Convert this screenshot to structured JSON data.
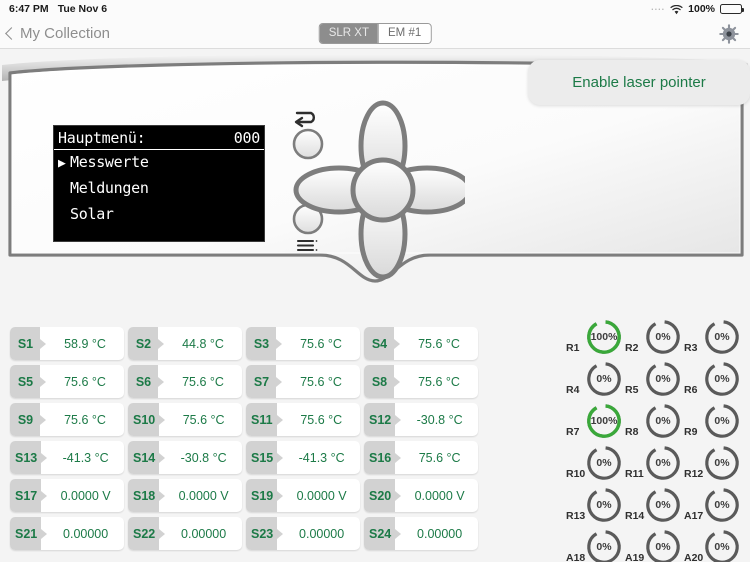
{
  "statusbar": {
    "time": "6:47 PM",
    "date": "Tue Nov 6",
    "dots": "....",
    "wifi_icon": "wifi-icon",
    "battery_pct": "100%",
    "battery_icon": "battery-full-icon"
  },
  "navbar": {
    "back_label": "My Collection",
    "back_icon": "chevron-left-icon",
    "gear_icon": "gear-icon",
    "segments": [
      {
        "label": "SLR XT",
        "selected": true
      },
      {
        "label": "EM #1",
        "selected": false
      }
    ]
  },
  "device": {
    "laser_button": "Enable laser pointer",
    "lcd": {
      "header_left": "Hauptmenü:",
      "header_right": "000",
      "caret": "▶",
      "items": [
        {
          "caret": "▶",
          "label": "Messwerte"
        },
        {
          "caret": "",
          "label": "Meldungen"
        },
        {
          "caret": "",
          "label": "Solar"
        }
      ]
    },
    "controls": {
      "back_icon": "undo-arrow-icon",
      "back_button": "round-button-back",
      "menu_icon": "list-menu-icon",
      "menu_button": "round-button-menu",
      "dpad": "dpad-navigation"
    }
  },
  "sensors": [
    {
      "label": "S1",
      "value": "58.9 °C"
    },
    {
      "label": "S2",
      "value": "44.8 °C"
    },
    {
      "label": "S3",
      "value": "75.6 °C"
    },
    {
      "label": "S4",
      "value": "75.6 °C"
    },
    {
      "label": "S5",
      "value": "75.6 °C"
    },
    {
      "label": "S6",
      "value": "75.6 °C"
    },
    {
      "label": "S7",
      "value": "75.6 °C"
    },
    {
      "label": "S8",
      "value": "75.6 °C"
    },
    {
      "label": "S9",
      "value": "75.6 °C"
    },
    {
      "label": "S10",
      "value": "75.6 °C"
    },
    {
      "label": "S11",
      "value": "75.6 °C"
    },
    {
      "label": "S12",
      "value": "-30.8 °C"
    },
    {
      "label": "S13",
      "value": "-41.3 °C"
    },
    {
      "label": "S14",
      "value": "-30.8 °C"
    },
    {
      "label": "S15",
      "value": "-41.3 °C"
    },
    {
      "label": "S16",
      "value": "75.6 °C"
    },
    {
      "label": "S17",
      "value": "0.0000 V"
    },
    {
      "label": "S18",
      "value": "0.0000 V"
    },
    {
      "label": "S19",
      "value": "0.0000 V"
    },
    {
      "label": "S20",
      "value": "0.0000 V"
    },
    {
      "label": "S21",
      "value": "0.00000"
    },
    {
      "label": "S22",
      "value": "0.00000"
    },
    {
      "label": "S23",
      "value": "0.00000"
    },
    {
      "label": "S24",
      "value": "0.00000"
    }
  ],
  "relays": [
    {
      "label": "R1",
      "value": "100%",
      "percent": 100
    },
    {
      "label": "R2",
      "value": "0%",
      "percent": 0
    },
    {
      "label": "R3",
      "value": "0%",
      "percent": 0
    },
    {
      "label": "R4",
      "value": "0%",
      "percent": 0
    },
    {
      "label": "R5",
      "value": "0%",
      "percent": 0
    },
    {
      "label": "R6",
      "value": "0%",
      "percent": 0
    },
    {
      "label": "R7",
      "value": "100%",
      "percent": 100
    },
    {
      "label": "R8",
      "value": "0%",
      "percent": 0
    },
    {
      "label": "R9",
      "value": "0%",
      "percent": 0
    },
    {
      "label": "R10",
      "value": "0%",
      "percent": 0
    },
    {
      "label": "R11",
      "value": "0%",
      "percent": 0
    },
    {
      "label": "R12",
      "value": "0%",
      "percent": 0
    },
    {
      "label": "R13",
      "value": "0%",
      "percent": 0
    },
    {
      "label": "R14",
      "value": "0%",
      "percent": 0
    },
    {
      "label": "A17",
      "value": "0%",
      "percent": 0
    },
    {
      "label": "A18",
      "value": "0%",
      "percent": 0
    },
    {
      "label": "A19",
      "value": "0%",
      "percent": 0
    },
    {
      "label": "A20",
      "value": "0%",
      "percent": 0
    }
  ],
  "colors": {
    "green_text": "#1c7a47",
    "gauge_active": "#3aa83a",
    "gauge_idle": "#5a5a5a",
    "chip_gray": "#d2d2d2"
  }
}
